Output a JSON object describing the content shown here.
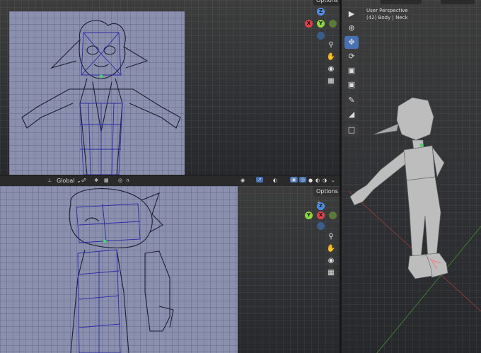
{
  "header": {
    "orientation_label": "Global",
    "options_label": "Options",
    "top_right_label": "Options"
  },
  "viewport3d": {
    "mode_title": "User Perspective",
    "object_info": "(42) Body | Neck"
  },
  "gizmo": {
    "axis_z": "Z",
    "axis_y": "Y",
    "axis_x": "X",
    "zoom_icon": "zoom-icon",
    "pan_icon": "pan-hand-icon",
    "camera_icon": "camera-icon",
    "grid_icon": "grid-icon"
  },
  "tools": [
    "select-box-icon",
    "cursor-icon",
    "move-icon",
    "rotate-icon",
    "scale-icon",
    "transform-icon",
    "annotate-icon",
    "measure-icon",
    "add-cube-icon"
  ],
  "colors": {
    "accent": "#4772b3",
    "axis_x": "#e0424b",
    "axis_y": "#8bd63b",
    "axis_z": "#4c8fe6",
    "reference_bg": "#8a90ad",
    "model": "#bfbfbf"
  }
}
